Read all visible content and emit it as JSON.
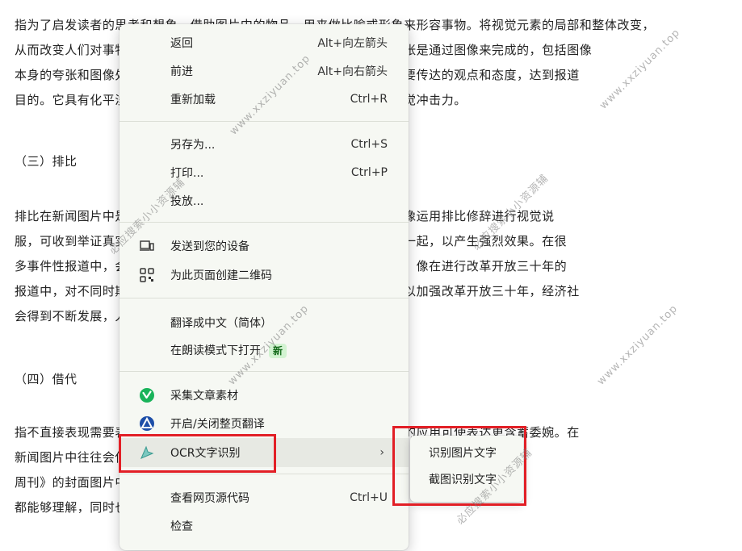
{
  "article": {
    "p1": [
      "指为了启发读者的思考和想象，借助图片中的物品，用来做比喻或形象来形容事物。将视觉元素的局部和整体改变，",
      "从而改变人们对事物的认知，达到一种夸张的视觉效果。视觉修辞的夸张是通过图像来完成的，包括图像",
      "本身的夸张和图像处理的夸张，通过夸张的手法，更能强调突出作者所要传达的观点和态度，达到报道",
      "目的。它具有化平淡为神奇的作用，在打破常规思维模式的同时增强视觉冲击力。"
    ],
    "h3": "（三）排比",
    "p2": [
      "排比在新闻图片中是把多幅结构相似的图片排列在一起的修辞现象。图像运用排比修辞进行视觉说",
      "服，可收到举证真实的效果，它把同类的事物或相类似的人或事排列在一起，以产生强烈效果。在很",
      "多事件性报道中，会使用多张同类新闻图片进行组合报道，以验证主题。像在进行改革开放三十年的",
      "报道中，对不同时期的同一地点进行拍摄，形成鲜明对比，相互映衬，以加强改革开放三十年，经济社",
      "会得到不断发展，人民生活水平不断提高的主题，更具说服力。"
    ],
    "h4": "（四）借代",
    "p3": [
      "指不直接表现需要表达的对象，而是借用与之相关的事物来代替。借代的应用可使表达更含蓄委婉。在",
      "新闻图片中往往会使用具有代表性的事物或符号来表现所要报道的形象。如某期《时代",
      "周刊》的封面图片中使用中国龙的形象来表现中国，用龙来借代中国时，既使读者",
      "都能够理解，同时也更加形象生动。"
    ]
  },
  "menu": {
    "back": {
      "label": "返回",
      "shortcut": "Alt+向左箭头"
    },
    "forward": {
      "label": "前进",
      "shortcut": "Alt+向右箭头"
    },
    "reload": {
      "label": "重新加载",
      "shortcut": "Ctrl+R"
    },
    "save_as": {
      "label": "另存为...",
      "shortcut": "Ctrl+S"
    },
    "print": {
      "label": "打印...",
      "shortcut": "Ctrl+P"
    },
    "cast": {
      "label": "投放..."
    },
    "send_to_devices": {
      "label": "发送到您的设备"
    },
    "create_qr": {
      "label": "为此页面创建二维码"
    },
    "translate": {
      "label": "翻译成中文（简体）"
    },
    "reading_mode": {
      "label": "在朗读模式下打开",
      "badge": "新"
    },
    "collect": {
      "label": "采集文章素材"
    },
    "toggle_translate": {
      "label": "开启/关闭整页翻译"
    },
    "ocr": {
      "label": "OCR文字识别",
      "chevron": "›"
    },
    "view_source": {
      "label": "查看网页源代码",
      "shortcut": "Ctrl+U"
    },
    "inspect": {
      "label": "检查"
    }
  },
  "submenu": {
    "recognize_image": "识别图片文字",
    "screenshot_ocr": "截图识别文字"
  },
  "watermark": "www.xxziyuan.top",
  "watermark_cn": "必应搜索小小资源辅",
  "colors": {
    "highlight_box": "#e21f26",
    "menu_bg": "#f6f8f3",
    "badge_bg": "#d2f3d1"
  }
}
